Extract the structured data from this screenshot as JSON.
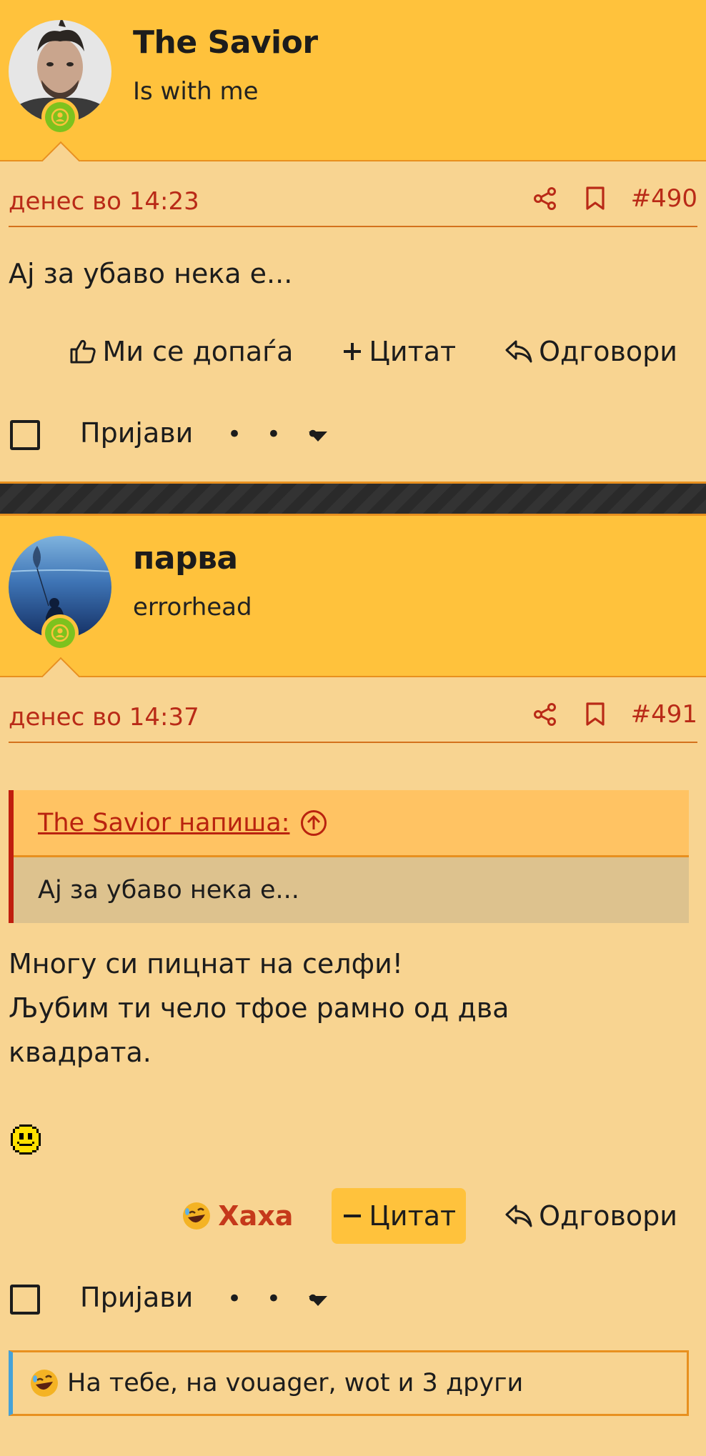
{
  "posts": [
    {
      "username": "The Savior",
      "user_title": "Is with me",
      "date": "денес во 14:23",
      "post_number": "#490",
      "body": [
        "Ај за убаво нека е..."
      ],
      "actions": {
        "like": "Ми се допаѓа",
        "quote": "Цитат",
        "reply": "Одговори"
      },
      "footer": {
        "report": "Пријави",
        "more": "• • •"
      }
    },
    {
      "username": "парва",
      "user_title": "errorhead",
      "date": "денес во 14:37",
      "post_number": "#491",
      "quote": {
        "author": "The Savior напиша:",
        "text": "Ај за убаво нека е..."
      },
      "body": [
        "Многу си пицнат на селфи!",
        "Љубим ти чело тфое рамно од два",
        "квадрата."
      ],
      "actions": {
        "reaction": "Хаха",
        "quote": "Цитат",
        "reply": "Одговори"
      },
      "footer": {
        "report": "Пријави",
        "more": "• • •"
      },
      "reactions_summary": "На тебе, на vouager, wot и 3 други"
    }
  ],
  "colors": {
    "header": "#ffc23c",
    "background": "#f8d491",
    "accent": "#b92a17",
    "border": "#e8901f",
    "online": "#7dc21e"
  },
  "icons": [
    "share-icon",
    "bookmark-icon",
    "thumbs-up-icon",
    "plus-icon",
    "minus-icon",
    "reply-icon",
    "laughing-emoji-icon",
    "smiley-icon",
    "arrow-up-circle-icon",
    "chevron-down-icon",
    "online-user-icon"
  ]
}
